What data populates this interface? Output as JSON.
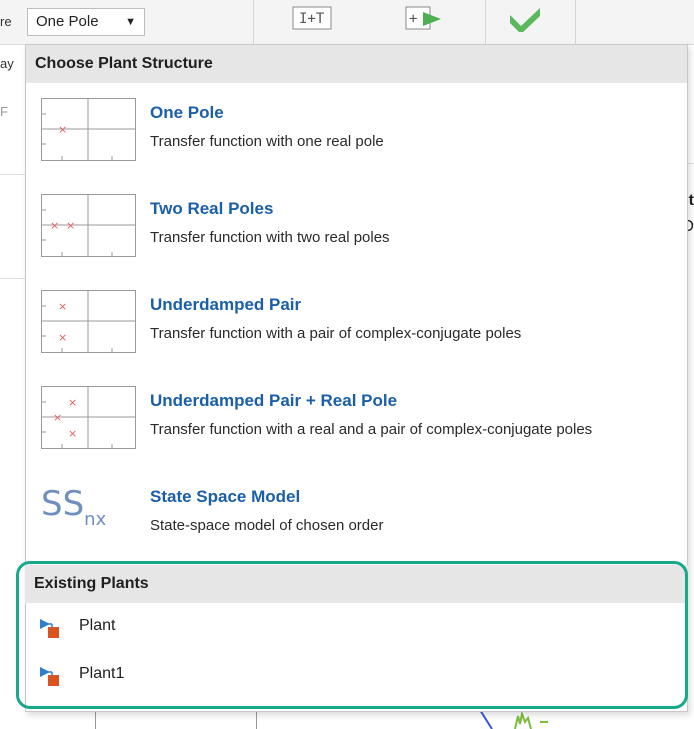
{
  "toolbar": {
    "dropdown_value": "One Pole",
    "left_fragments": [
      "re",
      "ay",
      "F"
    ],
    "right_fragments": [
      "nt",
      "O"
    ]
  },
  "popup": {
    "structures_header": "Choose Plant Structure",
    "items": [
      {
        "title": "One Pole",
        "desc": "Transfer function with one real pole",
        "icon": "one-pole-icon"
      },
      {
        "title": "Two Real Poles",
        "desc": "Transfer function with two real poles",
        "icon": "two-real-poles-icon"
      },
      {
        "title": "Underdamped Pair",
        "desc": "Transfer function with a pair of complex-conjugate poles",
        "icon": "underdamped-pair-icon"
      },
      {
        "title": "Underdamped Pair + Real Pole",
        "desc": "Transfer function with a real and a pair of complex-conjugate poles",
        "icon": "underdamped-pair-real-pole-icon"
      },
      {
        "title": "State Space Model",
        "desc": "State-space model of chosen order",
        "icon": "state-space-icon",
        "icon_text": "SS",
        "icon_sub": "nx"
      }
    ],
    "existing_header": "Existing Plants",
    "existing_plants": [
      {
        "label": "Plant",
        "icon": "plant-icon"
      },
      {
        "label": "Plant1",
        "icon": "plant-icon"
      }
    ],
    "accent_color": "#16a98a",
    "title_color": "#1a5fa8",
    "pole_mark_color": "#e06060"
  }
}
